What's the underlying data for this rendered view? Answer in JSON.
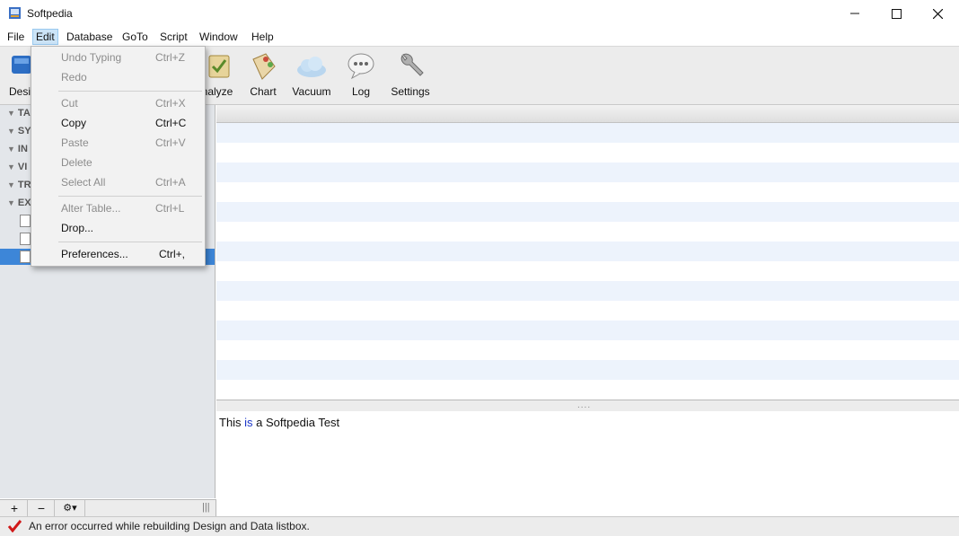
{
  "window": {
    "title": "Softpedia",
    "minimize": "—",
    "maximize": "☐",
    "close": "✕"
  },
  "menubar": {
    "items": [
      "File",
      "Edit",
      "Database",
      "GoTo",
      "Script",
      "Window",
      "Help"
    ],
    "active": "Edit"
  },
  "toolbar": {
    "design_label_partial": "Desi",
    "analyze_label_partial": "nalyze",
    "chart_label": "Chart",
    "vacuum_label": "Vacuum",
    "log_label": "Log",
    "settings_label": "Settings"
  },
  "sidebar": {
    "tree": [
      {
        "prefix": "TA"
      },
      {
        "prefix": "SY"
      },
      {
        "prefix": "IN"
      },
      {
        "prefix": "VI"
      },
      {
        "prefix": "TR"
      },
      {
        "prefix": "EX"
      }
    ],
    "bottom_buttons": [
      "+",
      "−",
      "⚙▾"
    ],
    "resize_grip": "|||"
  },
  "edit_menu": {
    "groups": [
      [
        {
          "label": "Undo Typing",
          "shortcut": "Ctrl+Z",
          "enabled": false
        },
        {
          "label": "Redo",
          "shortcut": "",
          "enabled": false
        }
      ],
      [
        {
          "label": "Cut",
          "shortcut": "Ctrl+X",
          "enabled": false
        },
        {
          "label": "Copy",
          "shortcut": "Ctrl+C",
          "enabled": true
        },
        {
          "label": "Paste",
          "shortcut": "Ctrl+V",
          "enabled": false
        },
        {
          "label": "Delete",
          "shortcut": "",
          "enabled": false
        },
        {
          "label": "Select All",
          "shortcut": "Ctrl+A",
          "enabled": false
        }
      ],
      [
        {
          "label": "Alter Table...",
          "shortcut": "Ctrl+L",
          "enabled": false
        },
        {
          "label": "Drop...",
          "shortcut": "",
          "enabled": true
        }
      ],
      [
        {
          "label": "Preferences...",
          "shortcut": "Ctrl+,",
          "enabled": true
        }
      ]
    ]
  },
  "editor": {
    "text_before": "This ",
    "keyword": "is",
    "text_after": " a Softpedia Test"
  },
  "splitter_handle": "....",
  "statusbar": {
    "message": "An error occurred while rebuilding Design and Data listbox."
  },
  "colors": {
    "selection": "#3d86d8",
    "stripe": "#edf3fc",
    "keyword": "#1a35c8",
    "status_ok": "#d01818"
  }
}
